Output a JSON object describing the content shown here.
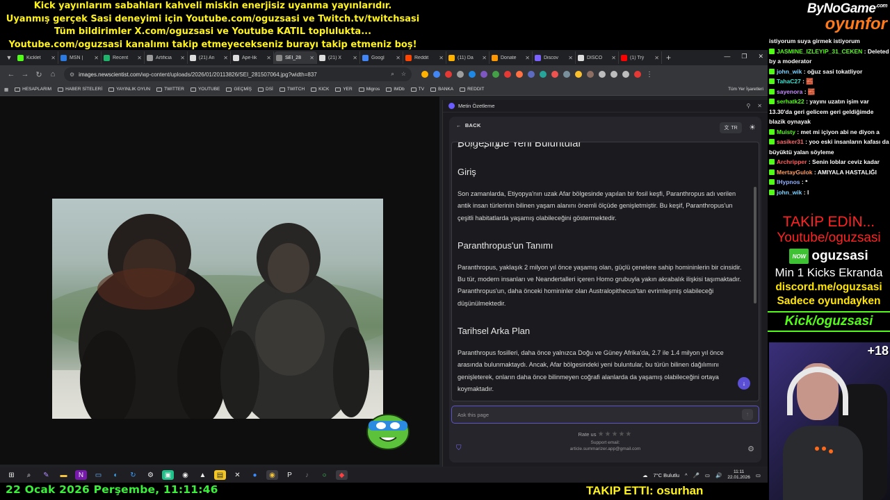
{
  "overlay": {
    "lines": [
      "Kick yayınlarım sabahları kahveli miskin enerjisiz uyanma yayınlarıdır.",
      "Uyanmış gerçek Sasi deneyimi için Youtube.com/oguzsasi ve Twitch.tv/twitchsasi",
      "Tüm bildirimler X.com/oguzsasi ve Youtube KATIL topluluktа...",
      "Youtube.com/oguzsasi kanalımı takip etmeyecekseniz burayı takip etmeniz boş!"
    ],
    "brand_top": "ByNoGame",
    "brand_com": ".com",
    "brand_bottom": "oyunfor",
    "date": "22 Ocak 2026 Perşembe, 11:11:46",
    "follow": "TAKIP ETTI: osurhan"
  },
  "browser": {
    "tabs": [
      {
        "label": "Kicklet",
        "color": "#53fc18"
      },
      {
        "label": "MSN |",
        "color": "#2a7ae2"
      },
      {
        "label": "Recent",
        "color": "#1fb36b"
      },
      {
        "label": "Artificia",
        "color": "#999999"
      },
      {
        "label": "(21) An",
        "color": "#dddddd"
      },
      {
        "label": "Ape-lik",
        "color": "#dddddd"
      },
      {
        "label": "SEI_28",
        "color": "#888888"
      },
      {
        "label": "(21) X",
        "color": "#dddddd"
      },
      {
        "label": "Googl",
        "color": "#4285f4"
      },
      {
        "label": "Reddit",
        "color": "#ff4500"
      },
      {
        "label": "(11) Da",
        "color": "#ffb300"
      },
      {
        "label": "Donate",
        "color": "#ff9800"
      },
      {
        "label": "Discov",
        "color": "#7b61ff"
      },
      {
        "label": "DISCO",
        "color": "#dddddd"
      },
      {
        "label": "(1) Trý",
        "color": "#ff0000"
      }
    ],
    "url_host": "images.newscientist.com",
    "url_path": "/wp-content/uploads/2026/01/20113826/SEI_281507064.jpg?width=837",
    "bookmarks": [
      "HESAPLARIM",
      "HABER SİTELERİ",
      "YAYINLIK OYUN",
      "TWITTER",
      "YOUTUBE",
      "GEÇMİŞ",
      "DSİ",
      "TWITCH",
      "KICK",
      "YER",
      "Migros",
      "IMDb",
      "TV",
      "BANKA",
      "REDDIT"
    ],
    "bookmarks_all": "Tüm Yer İşaretleri"
  },
  "panel": {
    "title": "Metin Özetleme",
    "back": "BACK",
    "lang": "TR",
    "article": [
      {
        "type": "h2",
        "text": "Bölgesinde Yeni Buluntular"
      },
      {
        "type": "h3",
        "text": "Giriş"
      },
      {
        "type": "p",
        "text": "Son zamanlarda, Etiyopya'nın uzak Afar bölgesinde yapılan bir fosil keşfi, Paranthropus adı verilen antik insan türlerinin bilinen yaşam alanını önemli ölçüde genişletmiştir. Bu keşif, Paranthropus'un çeşitli habitatlarda yaşamış olabileceğini göstermektedir."
      },
      {
        "type": "h3",
        "text": "Paranthropus'un Tanımı"
      },
      {
        "type": "p",
        "text": "Paranthropus, yaklaşık 2 milyon yıl önce yaşamış olan, güçlü çenelere sahip homininlerin bir cinsidir. Bu tür, modern insanları ve Neandertalleri içeren Homo grubuyla yakın akrabalık ilişkisi taşımaktadır. Paranthropus'un, daha önceki homininler olan Australopithecus'tan evrimleşmiş olabileceği düşünülmektedir."
      },
      {
        "type": "h3",
        "text": "Tarihsel Arka Plan"
      },
      {
        "type": "p",
        "text": "Paranthropus fosilleri, daha önce yalnızca Doğu ve Güney Afrika'da, 2.7 ile 1.4 milyon yıl önce arasında bulunmaktaydı. Ancak, Afar bölgesindeki yeni buluntular, bu türün bilinen dağılımını genişleterek, onların daha önce bilinmeyen coğrafi alanlarda da yaşamış olabileceğini ortaya koymaktadır."
      }
    ],
    "ask_placeholder": "Ask this page",
    "rate_label": "Rate us",
    "support_label": "Support email:",
    "support_email": "article.summarizer.app@gmail.com"
  },
  "taskbar": {
    "weather": "7°C  Bulutlu",
    "time": "11:11",
    "date": "22.01.2026"
  },
  "chat": [
    {
      "user": "",
      "color": "#ffffff",
      "text": "istiyorum suya girmek istiyorum"
    },
    {
      "user": "JASMINE_IZLEYIP_31_CEKEN",
      "color": "#53fc18",
      "text": "Deleted by a moderator"
    },
    {
      "user": "john_wik",
      "color": "#7fd3ff",
      "text": "oğuz sasi tokatliyor"
    },
    {
      "user": "TahaC27",
      "color": "#3fe0d0",
      "text": "🧱"
    },
    {
      "user": "sayenora",
      "color": "#c48cff",
      "text": "🧱"
    },
    {
      "user": "serhatk22",
      "color": "#53fc18",
      "text": "yayını uzatın işim var 13.30'da geri gelicem geri geldiğimde blazik oynayak"
    },
    {
      "user": "Muisty",
      "color": "#53fc18",
      "text": "met mi içiyon abi ne diyon a"
    },
    {
      "user": "sasiker31",
      "color": "#ff6a6a",
      "text": "yoo eski insanların kafası da büyüktü yalan söyleme"
    },
    {
      "user": "Archripper",
      "color": "#ff5f5f",
      "text": "Senin loblar ceviz kadar"
    },
    {
      "user": "MertayGulok",
      "color": "#ff9b5f",
      "text": "AMIYALA HASTALIĞI"
    },
    {
      "user": "lHypnos",
      "color": "#8fb0ff",
      "text": "*"
    },
    {
      "user": "john_wik",
      "color": "#7fd3ff",
      "text": "l"
    }
  ],
  "promo": {
    "follow": "TAKİP EDİN...",
    "youtube": "Youtube/oguzsasi",
    "now_badge": "NOW",
    "now_name": "oguzsasi",
    "kicks": "Min 1 Kicks Ekranda",
    "discord": "discord.me/oguzsasi",
    "only": "Sadece oyundayken",
    "kick": "Kick/oguzsasi"
  },
  "cam": {
    "badge": "+18"
  },
  "colors": {
    "overlay_yellow": "#fff31a",
    "kick_green": "#53fc18",
    "promo_red": "#ff2222",
    "panel_accent": "#5b55c8"
  }
}
